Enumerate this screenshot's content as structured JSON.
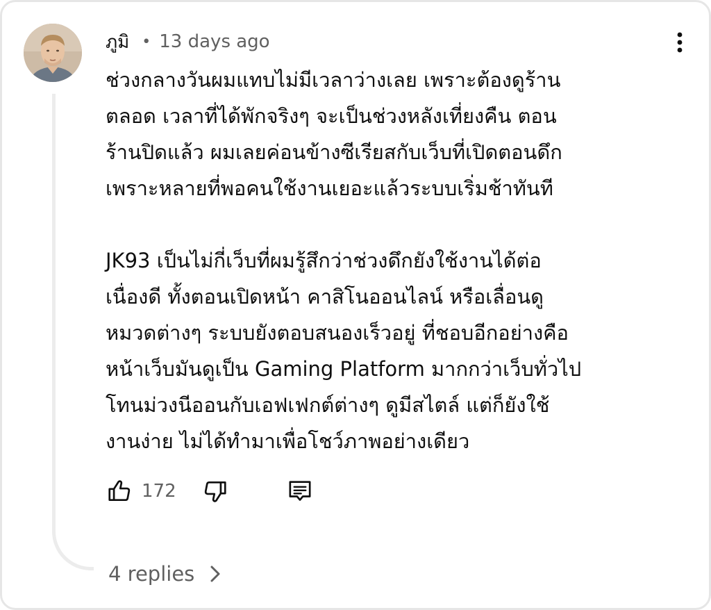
{
  "comment": {
    "author": "ภูมิ",
    "separator": "•",
    "timestamp": "13 days ago",
    "paragraphs": [
      "ช่วงกลางวันผมแทบไม่มีเวลาว่างเลย เพราะต้องดูร้าน\nตลอด เวลาที่ได้พักจริงๆ จะเป็นช่วงหลังเที่ยงคืน ตอน\nร้านปิดแล้ว ผมเลยค่อนข้างซีเรียสกับเว็บที่เปิดตอนดึก\nเพราะหลายที่พอคนใช้งานเยอะแล้วระบบเริ่มช้าทันที",
      "JK93 เป็นไม่กี่เว็บที่ผมรู้สึกว่าช่วงดึกยังใช้งานได้ต่อ\nเนื่องดี ทั้งตอนเปิดหน้า คาสิโนออนไลน์ หรือเลื่อนดู\nหมวดต่างๆ ระบบยังตอบสนองเร็วอยู่ ที่ชอบอีกอย่างคือ\nหน้าเว็บมันดูเป็น Gaming Platform มากกว่าเว็บทั่วไป\nโทนม่วงนีออนกับเอฟเฟกต์ต่างๆ ดูมีสไตล์ แต่ก็ยังใช้\nงานง่าย ไม่ได้ทำมาเพื่อโชว์ภาพอย่างเดียว"
    ],
    "like_count": "172",
    "replies_label": "4 replies"
  },
  "icons": {
    "avatar": "avatar",
    "more": "more-vert-icon",
    "like": "thumb-up-icon",
    "dislike": "thumb-down-icon",
    "reply": "comment-icon",
    "expand": "chevron-right-icon"
  },
  "colors": {
    "text_primary": "#0f0f0f",
    "text_secondary": "#606060",
    "thread_line": "#ececec",
    "frame_border": "#e6e6e6"
  }
}
